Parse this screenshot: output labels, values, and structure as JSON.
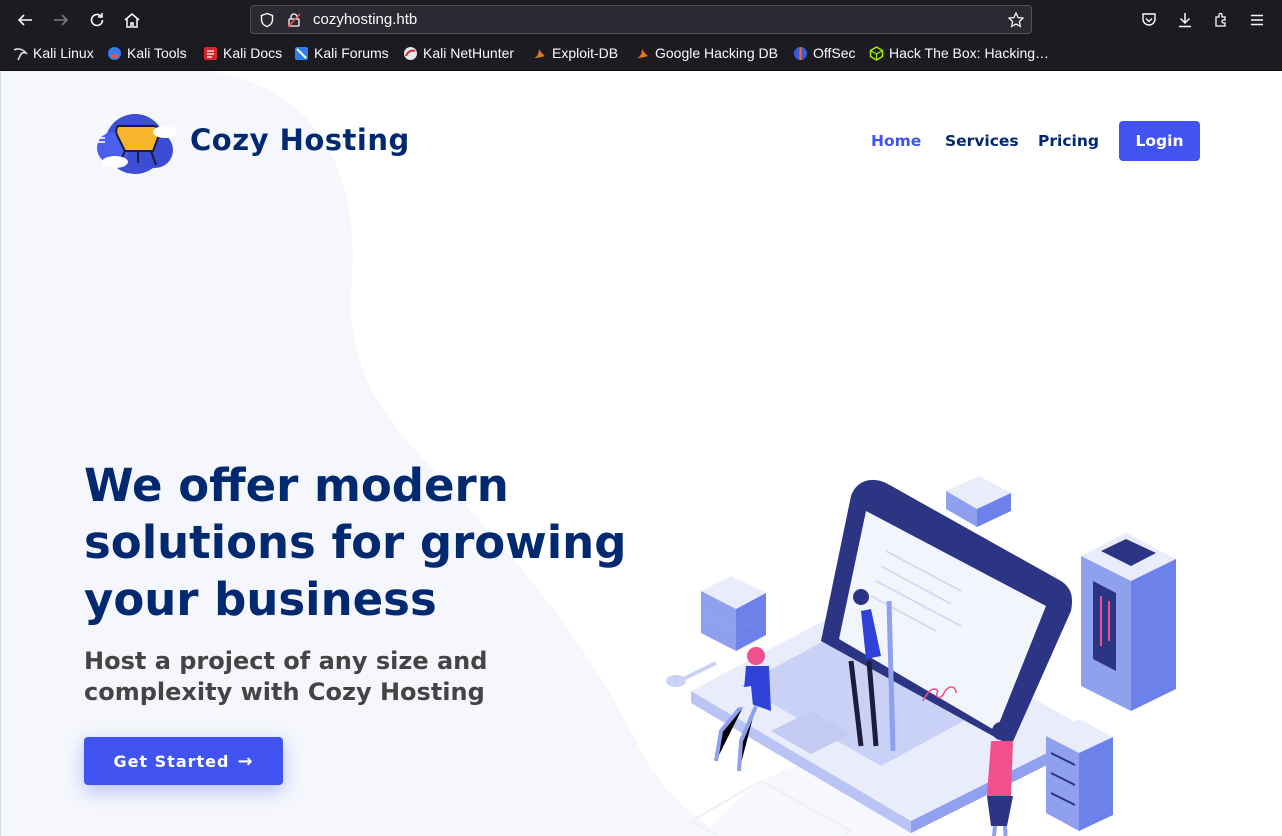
{
  "browser": {
    "url": "cozyhosting.htb",
    "bookmarks": [
      {
        "label": "Kali Linux",
        "icon": "kali-dragon-icon"
      },
      {
        "label": "Kali Tools",
        "icon": "kali-tools-icon"
      },
      {
        "label": "Kali Docs",
        "icon": "kali-docs-icon"
      },
      {
        "label": "Kali Forums",
        "icon": "kali-forums-icon"
      },
      {
        "label": "Kali NetHunter",
        "icon": "kali-nethunter-icon"
      },
      {
        "label": "Exploit-DB",
        "icon": "exploit-db-icon"
      },
      {
        "label": "Google Hacking DB",
        "icon": "ghdb-icon"
      },
      {
        "label": "OffSec",
        "icon": "offsec-icon"
      },
      {
        "label": "Hack The Box: Hacking…",
        "icon": "htb-icon"
      }
    ]
  },
  "header": {
    "brand": "Cozy Hosting",
    "nav": [
      "Home",
      "Services",
      "Pricing"
    ],
    "login_label": "Login"
  },
  "hero": {
    "title": "We offer modern solutions for growing your business",
    "subtitle": "Host a project of any size and complexity with Cozy Hosting",
    "cta_label": "Get Started",
    "cta_arrow": "→"
  },
  "colors": {
    "primary": "#4154f1",
    "navy": "#012970",
    "pink": "#f0508c"
  }
}
